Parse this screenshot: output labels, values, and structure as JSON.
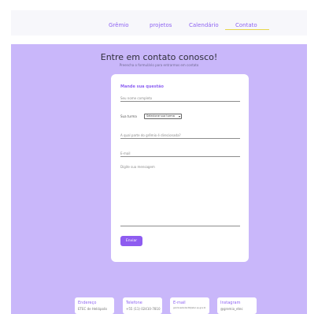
{
  "nav": {
    "items": [
      "Grêmio",
      "projetos",
      "Calendário",
      "Contato"
    ],
    "active": "Contato"
  },
  "hero": {
    "title": "Entre em contato conosco!",
    "subtitle": "Preencha o formulário para entrarmos em contato"
  },
  "form": {
    "title": "Mande sua questão",
    "name_placeholder": "Seu nome completo",
    "class_label": "Sua turma",
    "class_value": "Selecione sua turma",
    "department_placeholder": "A qual parte do grêmio é direcionada?",
    "email_placeholder": "E-mail",
    "message_placeholder": "Digite sua mensagem",
    "send_label": "Enviar"
  },
  "footer": {
    "cards": [
      {
        "title": "Endereço",
        "text": "ETEC de Heliópolis"
      },
      {
        "title": "Telefone",
        "text": "+55 (11) 02410-7810"
      },
      {
        "title": "E-mail",
        "text": "gremioestudantil@etec.sp.gov.br"
      },
      {
        "title": "Instagram",
        "text": "@gremio_etec"
      }
    ]
  },
  "colors": {
    "accent": "#8e63f2",
    "hero_bg": "#c9b7fa",
    "underline": "#e6d64a"
  }
}
